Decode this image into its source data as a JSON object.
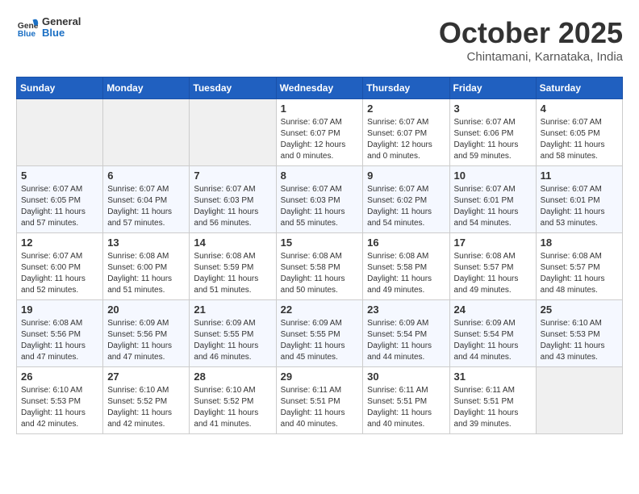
{
  "header": {
    "logo_line1": "General",
    "logo_line2": "Blue",
    "month": "October 2025",
    "location": "Chintamani, Karnataka, India"
  },
  "days_of_week": [
    "Sunday",
    "Monday",
    "Tuesday",
    "Wednesday",
    "Thursday",
    "Friday",
    "Saturday"
  ],
  "weeks": [
    [
      {
        "day": "",
        "info": ""
      },
      {
        "day": "",
        "info": ""
      },
      {
        "day": "",
        "info": ""
      },
      {
        "day": "1",
        "info": "Sunrise: 6:07 AM\nSunset: 6:07 PM\nDaylight: 12 hours\nand 0 minutes."
      },
      {
        "day": "2",
        "info": "Sunrise: 6:07 AM\nSunset: 6:07 PM\nDaylight: 12 hours\nand 0 minutes."
      },
      {
        "day": "3",
        "info": "Sunrise: 6:07 AM\nSunset: 6:06 PM\nDaylight: 11 hours\nand 59 minutes."
      },
      {
        "day": "4",
        "info": "Sunrise: 6:07 AM\nSunset: 6:05 PM\nDaylight: 11 hours\nand 58 minutes."
      }
    ],
    [
      {
        "day": "5",
        "info": "Sunrise: 6:07 AM\nSunset: 6:05 PM\nDaylight: 11 hours\nand 57 minutes."
      },
      {
        "day": "6",
        "info": "Sunrise: 6:07 AM\nSunset: 6:04 PM\nDaylight: 11 hours\nand 57 minutes."
      },
      {
        "day": "7",
        "info": "Sunrise: 6:07 AM\nSunset: 6:03 PM\nDaylight: 11 hours\nand 56 minutes."
      },
      {
        "day": "8",
        "info": "Sunrise: 6:07 AM\nSunset: 6:03 PM\nDaylight: 11 hours\nand 55 minutes."
      },
      {
        "day": "9",
        "info": "Sunrise: 6:07 AM\nSunset: 6:02 PM\nDaylight: 11 hours\nand 54 minutes."
      },
      {
        "day": "10",
        "info": "Sunrise: 6:07 AM\nSunset: 6:01 PM\nDaylight: 11 hours\nand 54 minutes."
      },
      {
        "day": "11",
        "info": "Sunrise: 6:07 AM\nSunset: 6:01 PM\nDaylight: 11 hours\nand 53 minutes."
      }
    ],
    [
      {
        "day": "12",
        "info": "Sunrise: 6:07 AM\nSunset: 6:00 PM\nDaylight: 11 hours\nand 52 minutes."
      },
      {
        "day": "13",
        "info": "Sunrise: 6:08 AM\nSunset: 6:00 PM\nDaylight: 11 hours\nand 51 minutes."
      },
      {
        "day": "14",
        "info": "Sunrise: 6:08 AM\nSunset: 5:59 PM\nDaylight: 11 hours\nand 51 minutes."
      },
      {
        "day": "15",
        "info": "Sunrise: 6:08 AM\nSunset: 5:58 PM\nDaylight: 11 hours\nand 50 minutes."
      },
      {
        "day": "16",
        "info": "Sunrise: 6:08 AM\nSunset: 5:58 PM\nDaylight: 11 hours\nand 49 minutes."
      },
      {
        "day": "17",
        "info": "Sunrise: 6:08 AM\nSunset: 5:57 PM\nDaylight: 11 hours\nand 49 minutes."
      },
      {
        "day": "18",
        "info": "Sunrise: 6:08 AM\nSunset: 5:57 PM\nDaylight: 11 hours\nand 48 minutes."
      }
    ],
    [
      {
        "day": "19",
        "info": "Sunrise: 6:08 AM\nSunset: 5:56 PM\nDaylight: 11 hours\nand 47 minutes."
      },
      {
        "day": "20",
        "info": "Sunrise: 6:09 AM\nSunset: 5:56 PM\nDaylight: 11 hours\nand 47 minutes."
      },
      {
        "day": "21",
        "info": "Sunrise: 6:09 AM\nSunset: 5:55 PM\nDaylight: 11 hours\nand 46 minutes."
      },
      {
        "day": "22",
        "info": "Sunrise: 6:09 AM\nSunset: 5:55 PM\nDaylight: 11 hours\nand 45 minutes."
      },
      {
        "day": "23",
        "info": "Sunrise: 6:09 AM\nSunset: 5:54 PM\nDaylight: 11 hours\nand 44 minutes."
      },
      {
        "day": "24",
        "info": "Sunrise: 6:09 AM\nSunset: 5:54 PM\nDaylight: 11 hours\nand 44 minutes."
      },
      {
        "day": "25",
        "info": "Sunrise: 6:10 AM\nSunset: 5:53 PM\nDaylight: 11 hours\nand 43 minutes."
      }
    ],
    [
      {
        "day": "26",
        "info": "Sunrise: 6:10 AM\nSunset: 5:53 PM\nDaylight: 11 hours\nand 42 minutes."
      },
      {
        "day": "27",
        "info": "Sunrise: 6:10 AM\nSunset: 5:52 PM\nDaylight: 11 hours\nand 42 minutes."
      },
      {
        "day": "28",
        "info": "Sunrise: 6:10 AM\nSunset: 5:52 PM\nDaylight: 11 hours\nand 41 minutes."
      },
      {
        "day": "29",
        "info": "Sunrise: 6:11 AM\nSunset: 5:51 PM\nDaylight: 11 hours\nand 40 minutes."
      },
      {
        "day": "30",
        "info": "Sunrise: 6:11 AM\nSunset: 5:51 PM\nDaylight: 11 hours\nand 40 minutes."
      },
      {
        "day": "31",
        "info": "Sunrise: 6:11 AM\nSunset: 5:51 PM\nDaylight: 11 hours\nand 39 minutes."
      },
      {
        "day": "",
        "info": ""
      }
    ]
  ]
}
